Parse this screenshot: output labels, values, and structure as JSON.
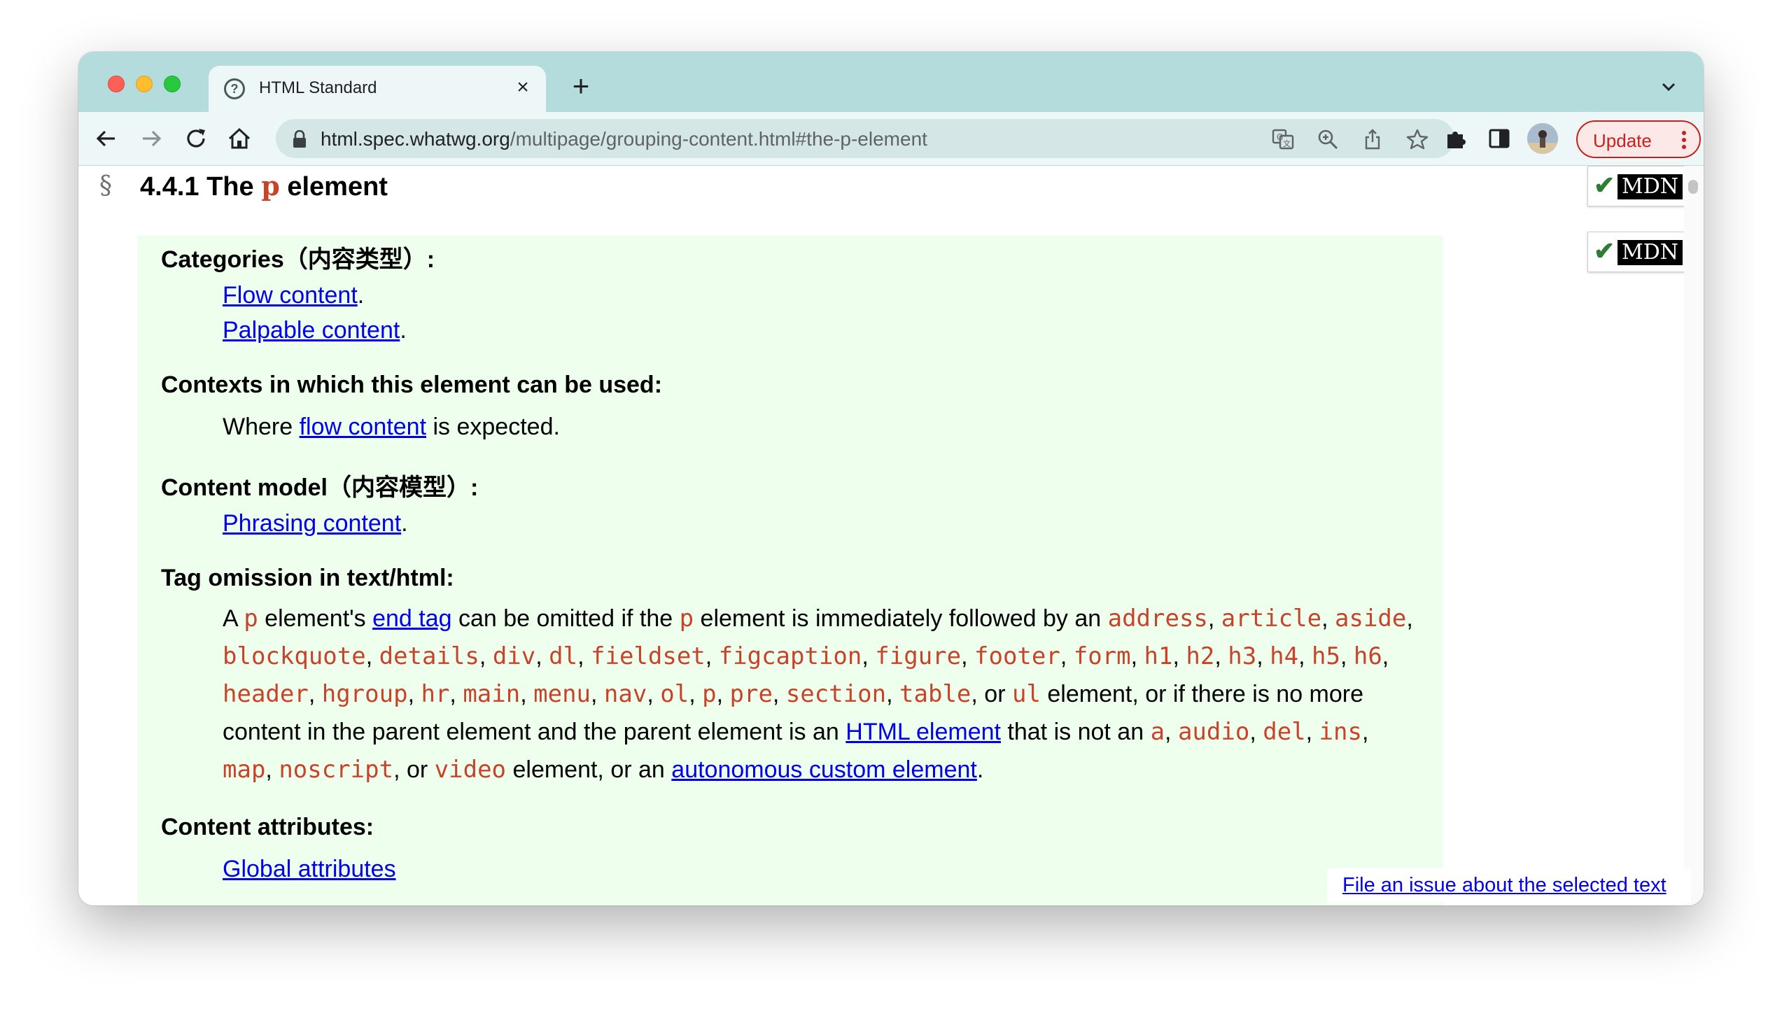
{
  "browser": {
    "tab": {
      "title": "HTML Standard"
    },
    "url": {
      "host": "html.spec.whatwg.org",
      "path": "/multipage/grouping-content.html#the-p-element"
    },
    "update_label": "Update"
  },
  "page": {
    "section_mark": "§",
    "heading": {
      "prefix": "4.4.1 The",
      "code": "p",
      "suffix": "element"
    },
    "mdn_label": "MDN",
    "categories": {
      "term": "Categories（内容类型）:",
      "items": [
        {
          "link": "Flow content",
          "after": "."
        },
        {
          "link": "Palpable content",
          "after": "."
        }
      ]
    },
    "contexts": {
      "term": "Contexts in which this element can be used:",
      "before": "Where ",
      "link": "flow content",
      "after": " is expected."
    },
    "content_model": {
      "term": "Content model（内容模型）:",
      "link": "Phrasing content",
      "after": "."
    },
    "tag_omission": {
      "term": "Tag omission in text/html:",
      "t1": "A ",
      "c1": "p",
      "t2": " element's ",
      "link1": "end tag",
      "t3": " can be omitted if the ",
      "c2": "p",
      "t4": " element is immediately followed by an ",
      "elements": [
        "address",
        "article",
        "aside",
        "blockquote",
        "details",
        "div",
        "dl",
        "fieldset",
        "figcaption",
        "figure",
        "footer",
        "form",
        "h1",
        "h2",
        "h3",
        "h4",
        "h5",
        "h6",
        "header",
        "hgroup",
        "hr",
        "main",
        "menu",
        "nav",
        "ol",
        "p",
        "pre",
        "section",
        "table"
      ],
      "or1": ", or ",
      "c_ul": "ul",
      "t5": " element, or if there is no more content in the parent element and the parent element is an ",
      "link2": "HTML element",
      "t6": " that is not an ",
      "parents": [
        "a",
        "audio",
        "del",
        "ins",
        "map",
        "noscript"
      ],
      "or2": ", or ",
      "c_video": "video",
      "t7": " element, or an ",
      "link3": "autonomous custom element",
      "t8": "."
    },
    "content_attributes": {
      "term": "Content attributes:",
      "link": "Global attributes"
    },
    "file_issue": "File an issue about the selected text"
  }
}
